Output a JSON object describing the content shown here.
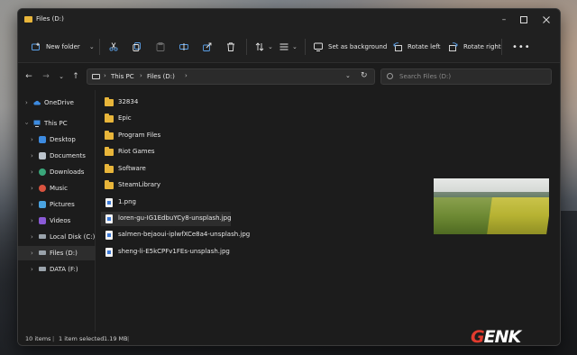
{
  "window": {
    "title": "Files (D:)"
  },
  "toolbar": {
    "new_label": "New folder",
    "set_background_label": "Set as background",
    "rotate_left_label": "Rotate left",
    "rotate_right_label": "Rotate right"
  },
  "address": {
    "crumbs": [
      "This PC",
      "Files (D:)"
    ],
    "search_placeholder": "Search Files (D:)"
  },
  "sidebar": {
    "items": [
      {
        "label": "OneDrive",
        "icon": "cloud-icon"
      },
      {
        "label": "This PC",
        "icon": "computer-icon"
      },
      {
        "label": "Desktop",
        "icon": "desktop-icon"
      },
      {
        "label": "Documents",
        "icon": "documents-icon"
      },
      {
        "label": "Downloads",
        "icon": "downloads-icon"
      },
      {
        "label": "Music",
        "icon": "music-icon"
      },
      {
        "label": "Pictures",
        "icon": "pictures-icon"
      },
      {
        "label": "Videos",
        "icon": "videos-icon"
      },
      {
        "label": "Local Disk (C:)",
        "icon": "drive-icon"
      },
      {
        "label": "Files (D:)",
        "icon": "drive-icon"
      },
      {
        "label": "DATA (F:)",
        "icon": "drive-icon"
      }
    ],
    "selected_index": 9
  },
  "files": [
    {
      "name": "32834",
      "type": "folder"
    },
    {
      "name": "Epic",
      "type": "folder"
    },
    {
      "name": "Program Files",
      "type": "folder"
    },
    {
      "name": "Riot Games",
      "type": "folder"
    },
    {
      "name": "Software",
      "type": "folder"
    },
    {
      "name": "SteamLibrary",
      "type": "folder"
    },
    {
      "name": "1.png",
      "type": "image"
    },
    {
      "name": "loren-gu-IG1EdbuYCy8-unsplash.jpg",
      "type": "image"
    },
    {
      "name": "salmen-bejaoui-iplwfXCe8a4-unsplash.jpg",
      "type": "image"
    },
    {
      "name": "sheng-li-E5kCPFv1FEs-unsplash.jpg",
      "type": "image"
    }
  ],
  "selected_file_index": 7,
  "status": {
    "item_count": "10 items",
    "selection": "1 item selected",
    "size": "1.19 MB",
    "separator": "|"
  },
  "watermark": {
    "first": "G",
    "rest": "ENK"
  },
  "colors": {
    "folder": "#e8b53a",
    "window_bg": "#1c1c1c",
    "selection": "#2d2d2d",
    "watermark_red": "#e23b2e"
  }
}
